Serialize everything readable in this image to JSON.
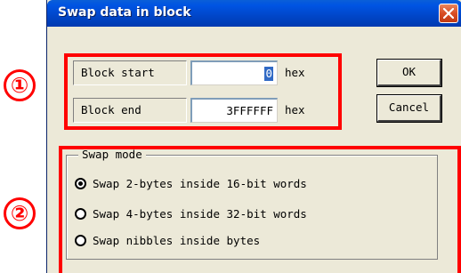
{
  "window": {
    "title": "Swap data in block"
  },
  "block_start": {
    "label": "Block start",
    "value": "0",
    "unit": "hex"
  },
  "block_end": {
    "label": "Block end",
    "value": "3FFFFFF",
    "unit": "hex"
  },
  "buttons": {
    "ok": "OK",
    "cancel": "Cancel"
  },
  "swap_mode": {
    "legend": "Swap mode",
    "options": [
      {
        "label": "Swap 2-bytes inside 16-bit words",
        "selected": true
      },
      {
        "label": "Swap 4-bytes inside 32-bit words",
        "selected": false
      },
      {
        "label": "Swap nibbles inside bytes",
        "selected": false
      }
    ]
  },
  "annotations": {
    "marker_1": "①",
    "marker_2": "②",
    "color": "#ff0000"
  },
  "colors": {
    "titlebar": "#0054e3",
    "dialog_bg": "#ece9d8",
    "close_button": "#d84d24"
  }
}
